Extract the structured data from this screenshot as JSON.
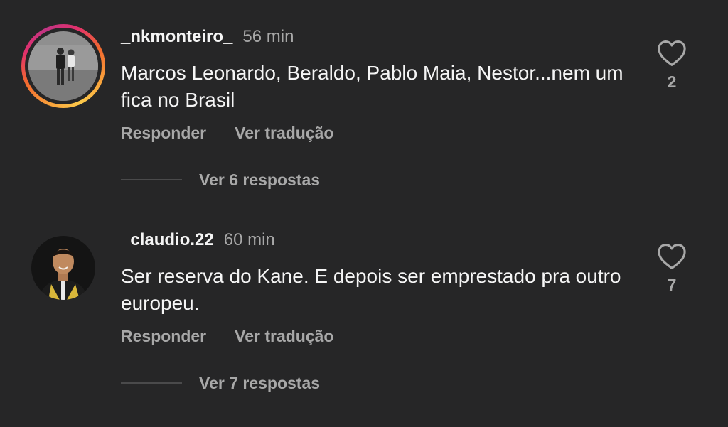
{
  "comments": [
    {
      "username": "_nkmonteiro_",
      "time": "56 min",
      "text": "Marcos Leonardo, Beraldo, Pablo Maia, Nestor...nem um fica no Brasil",
      "reply_label": "Responder",
      "translate_label": "Ver tradução",
      "likes": "2",
      "view_replies": "Ver 6 respostas",
      "has_story_ring": true
    },
    {
      "username": "_claudio.22",
      "time": "60 min",
      "text": "Ser reserva do Kane. E depois ser emprestado pra outro europeu.",
      "reply_label": "Responder",
      "translate_label": "Ver tradução",
      "likes": "7",
      "view_replies": "Ver 7 respostas",
      "has_story_ring": false
    }
  ],
  "icons": {
    "like": "heart-outline-icon"
  },
  "colors": {
    "background": "#262627",
    "primary_text": "#f5f5f5",
    "secondary_text": "#a8a8a8"
  }
}
